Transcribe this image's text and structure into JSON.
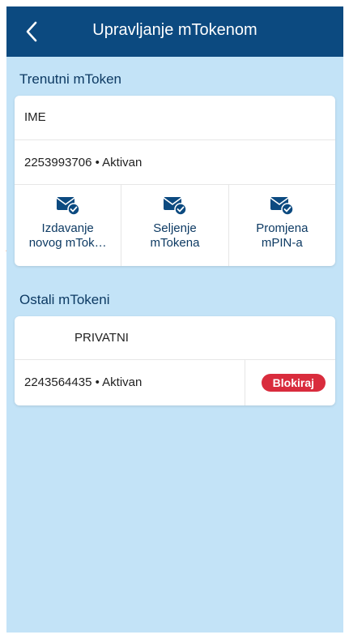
{
  "header": {
    "title": "Upravljanje mTokenom",
    "back_icon": "chevron-left-icon"
  },
  "current": {
    "section_title": "Trenutni mToken",
    "name": "IME",
    "token_line": "2253993706 • Aktivan",
    "actions": [
      {
        "label_line1": "Izdavanje",
        "label_line2": "novog mTok…",
        "icon": "mail-check-icon"
      },
      {
        "label_line1": "Seljenje",
        "label_line2": "mTokena",
        "icon": "mail-check-icon"
      },
      {
        "label_line1": "Promjena",
        "label_line2": "mPIN-a",
        "icon": "mail-check-icon"
      }
    ]
  },
  "others": {
    "section_title": "Ostali mTokeni",
    "name": "PRIVATNI",
    "token_line": "2243564435 • Aktivan",
    "block_label": "Blokiraj"
  },
  "colors": {
    "header_bg": "#0c4a80",
    "page_bg": "#c3e3f7",
    "accent_text": "#0d3a63",
    "danger": "#d92c3d",
    "hint": "#f0743a"
  }
}
